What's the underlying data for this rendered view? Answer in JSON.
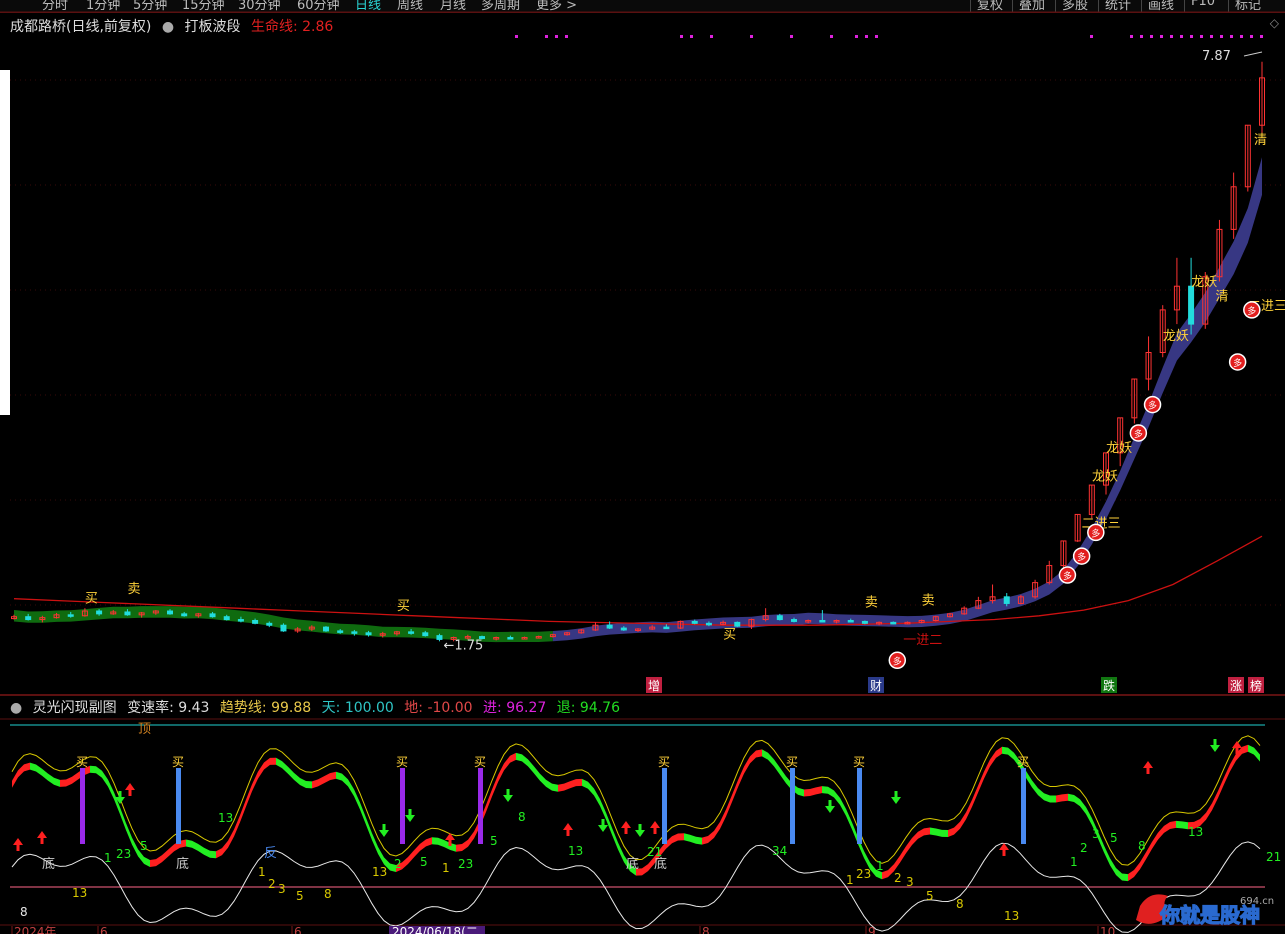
{
  "toolbar": {
    "timeframes": [
      "分时",
      "1分钟",
      "5分钟",
      "15分钟",
      "30分钟",
      "60分钟",
      "日线",
      "周线",
      "月线",
      "多周期",
      "更多 >"
    ],
    "active": "日线",
    "right_buttons": [
      "复权",
      "叠加",
      "多股",
      "统计",
      "画线",
      "F10",
      "标记"
    ]
  },
  "main_title": {
    "stock": "成都路桥(日线,前复权)",
    "indicator": "打板波段",
    "life_line_label": "生命线:",
    "life_line_value": "2.86"
  },
  "sub_title": {
    "name": "灵光闪现副图",
    "speed_label": "变速率:",
    "speed_value": "9.43",
    "trend_label": "趋势线:",
    "trend_value": "99.88",
    "sky_label": "天:",
    "sky_value": "100.00",
    "ground_label": "地:",
    "ground_value": "-10.00",
    "enter_label": "进:",
    "enter_value": "96.27",
    "exit_label": "退:",
    "exit_value": "94.76"
  },
  "colors": {
    "up": "#ff3333",
    "down": "#22dddd",
    "life_line": "#cc1111",
    "band_up": "#3a3a8a",
    "band_down": "#117711",
    "signal_yellow": "#ffd23a",
    "sub_red": "#ff2020",
    "sub_green": "#22ee22",
    "sub_yellow": "#d8c800",
    "sub_white": "#e8e8e8",
    "violet_bar": "#9a2aea",
    "blue_bar": "#4a8af0",
    "cyan_line": "#1fd1d1",
    "magenta": "#dd22dd",
    "pink_line": "#ff6688"
  },
  "main_annotations": {
    "high": "7.87",
    "low": "1.75",
    "buy": "买",
    "sell": "卖",
    "jin_er": "一进二",
    "er_ban_san": "二进三",
    "long_yao": "龙妖",
    "qing": "清",
    "duo": "多"
  },
  "bottom_markers": [
    "增",
    "财",
    "跌",
    "涨",
    "榜"
  ],
  "sub_annotations": {
    "top": "顶",
    "bottom": "底",
    "reverse": "反",
    "buy": "买"
  },
  "date_labels": [
    "2024年",
    "6",
    "6",
    "2024/06/18(二",
    "8",
    "9",
    "10"
  ],
  "watermark": {
    "text": "你就是股神",
    "site": "694.cn"
  },
  "chart_data": {
    "type": "candlestick",
    "title": "成都路桥(日线,前复权)",
    "ylim": [
      1.5,
      8.1
    ],
    "annotated_high": 7.87,
    "annotated_low": 1.75,
    "life_line_last": 2.86,
    "candles": [
      [
        1.99,
        2.03,
        1.98,
        2.01
      ],
      [
        2.01,
        2.04,
        1.97,
        1.98
      ],
      [
        1.98,
        2.02,
        1.95,
        2.0
      ],
      [
        2.0,
        2.05,
        1.99,
        2.03
      ],
      [
        2.03,
        2.06,
        2.0,
        2.02
      ],
      [
        2.02,
        2.1,
        2.01,
        2.07
      ],
      [
        2.07,
        2.09,
        2.02,
        2.04
      ],
      [
        2.04,
        2.08,
        2.03,
        2.06
      ],
      [
        2.06,
        2.09,
        2.02,
        2.03
      ],
      [
        2.03,
        2.06,
        2.0,
        2.05
      ],
      [
        2.05,
        2.08,
        2.03,
        2.07
      ],
      [
        2.07,
        2.09,
        2.03,
        2.04
      ],
      [
        2.04,
        2.06,
        2.01,
        2.02
      ],
      [
        2.02,
        2.05,
        2.0,
        2.04
      ],
      [
        2.04,
        2.06,
        2.0,
        2.01
      ],
      [
        2.01,
        2.03,
        1.97,
        1.98
      ],
      [
        1.98,
        2.01,
        1.95,
        1.97
      ],
      [
        1.97,
        1.99,
        1.93,
        1.94
      ],
      [
        1.94,
        1.96,
        1.9,
        1.92
      ],
      [
        1.92,
        1.94,
        1.85,
        1.86
      ],
      [
        1.86,
        1.9,
        1.84,
        1.88
      ],
      [
        1.88,
        1.92,
        1.86,
        1.9
      ],
      [
        1.9,
        1.91,
        1.85,
        1.86
      ],
      [
        1.86,
        1.88,
        1.83,
        1.85
      ],
      [
        1.85,
        1.87,
        1.81,
        1.84
      ],
      [
        1.84,
        1.86,
        1.8,
        1.82
      ],
      [
        1.82,
        1.85,
        1.79,
        1.83
      ],
      [
        1.83,
        1.86,
        1.81,
        1.85
      ],
      [
        1.85,
        1.88,
        1.82,
        1.84
      ],
      [
        1.84,
        1.86,
        1.8,
        1.81
      ],
      [
        1.81,
        1.83,
        1.75,
        1.77
      ],
      [
        1.77,
        1.8,
        1.75,
        1.79
      ],
      [
        1.79,
        1.82,
        1.77,
        1.8
      ],
      [
        1.8,
        1.81,
        1.77,
        1.78
      ],
      [
        1.78,
        1.8,
        1.76,
        1.79
      ],
      [
        1.79,
        1.81,
        1.77,
        1.78
      ],
      [
        1.78,
        1.8,
        1.77,
        1.79
      ],
      [
        1.79,
        1.81,
        1.78,
        1.8
      ],
      [
        1.8,
        1.83,
        1.79,
        1.82
      ],
      [
        1.82,
        1.85,
        1.81,
        1.84
      ],
      [
        1.84,
        1.88,
        1.83,
        1.87
      ],
      [
        1.87,
        1.95,
        1.86,
        1.92
      ],
      [
        1.92,
        1.96,
        1.88,
        1.89
      ],
      [
        1.89,
        1.91,
        1.86,
        1.87
      ],
      [
        1.87,
        1.89,
        1.85,
        1.88
      ],
      [
        1.88,
        1.92,
        1.87,
        1.9
      ],
      [
        1.9,
        1.93,
        1.88,
        1.89
      ],
      [
        1.89,
        1.97,
        1.88,
        1.96
      ],
      [
        1.96,
        1.98,
        1.93,
        1.94
      ],
      [
        1.94,
        1.96,
        1.91,
        1.93
      ],
      [
        1.93,
        1.97,
        1.92,
        1.95
      ],
      [
        1.95,
        1.96,
        1.9,
        1.91
      ],
      [
        1.91,
        1.99,
        1.88,
        1.98
      ],
      [
        1.98,
        2.1,
        1.96,
        2.02
      ],
      [
        2.02,
        2.04,
        1.97,
        1.98
      ],
      [
        1.98,
        2.0,
        1.95,
        1.96
      ],
      [
        1.96,
        1.98,
        1.94,
        1.97
      ],
      [
        1.97,
        2.08,
        1.95,
        1.96
      ],
      [
        1.96,
        1.98,
        1.94,
        1.97
      ],
      [
        1.97,
        1.99,
        1.95,
        1.96
      ],
      [
        1.96,
        1.97,
        1.93,
        1.94
      ],
      [
        1.94,
        1.96,
        1.92,
        1.95
      ],
      [
        1.95,
        1.96,
        1.93,
        1.94
      ],
      [
        1.94,
        1.96,
        1.93,
        1.95
      ],
      [
        1.95,
        1.98,
        1.94,
        1.97
      ],
      [
        1.97,
        2.02,
        1.96,
        2.01
      ],
      [
        2.01,
        2.05,
        2.0,
        2.04
      ],
      [
        2.04,
        2.12,
        2.03,
        2.1
      ],
      [
        2.1,
        2.22,
        2.09,
        2.18
      ],
      [
        2.18,
        2.35,
        2.15,
        2.22
      ],
      [
        2.22,
        2.26,
        2.12,
        2.15
      ],
      [
        2.15,
        2.24,
        2.14,
        2.22
      ],
      [
        2.22,
        2.4,
        2.2,
        2.37
      ],
      [
        2.37,
        2.6,
        2.35,
        2.55
      ],
      [
        2.55,
        2.81,
        2.53,
        2.81
      ],
      [
        2.81,
        3.09,
        2.8,
        3.09
      ],
      [
        3.09,
        3.4,
        3.05,
        3.4
      ],
      [
        3.4,
        3.74,
        3.3,
        3.74
      ],
      [
        3.74,
        4.11,
        3.6,
        4.11
      ],
      [
        4.11,
        4.52,
        4.05,
        4.52
      ],
      [
        4.52,
        4.97,
        4.4,
        4.8
      ],
      [
        4.8,
        5.3,
        4.75,
        5.25
      ],
      [
        5.25,
        5.8,
        5.1,
        5.5
      ],
      [
        5.5,
        5.8,
        4.99,
        5.1
      ],
      [
        5.1,
        5.65,
        5.05,
        5.6
      ],
      [
        5.6,
        6.2,
        5.55,
        6.1
      ],
      [
        6.1,
        6.7,
        6.0,
        6.55
      ],
      [
        6.55,
        7.2,
        6.5,
        7.2
      ],
      [
        7.2,
        7.87,
        7.1,
        7.7
      ]
    ],
    "life_line": [
      2.2,
      2.18,
      2.16,
      2.14,
      2.12,
      2.1,
      2.08,
      2.06,
      2.04,
      2.02,
      2.0,
      1.98,
      1.96,
      1.95,
      1.94,
      1.93,
      1.92,
      1.92,
      1.92,
      1.93,
      1.94,
      1.96,
      1.98,
      2.02,
      2.08,
      2.18,
      2.35,
      2.6,
      2.86
    ]
  }
}
